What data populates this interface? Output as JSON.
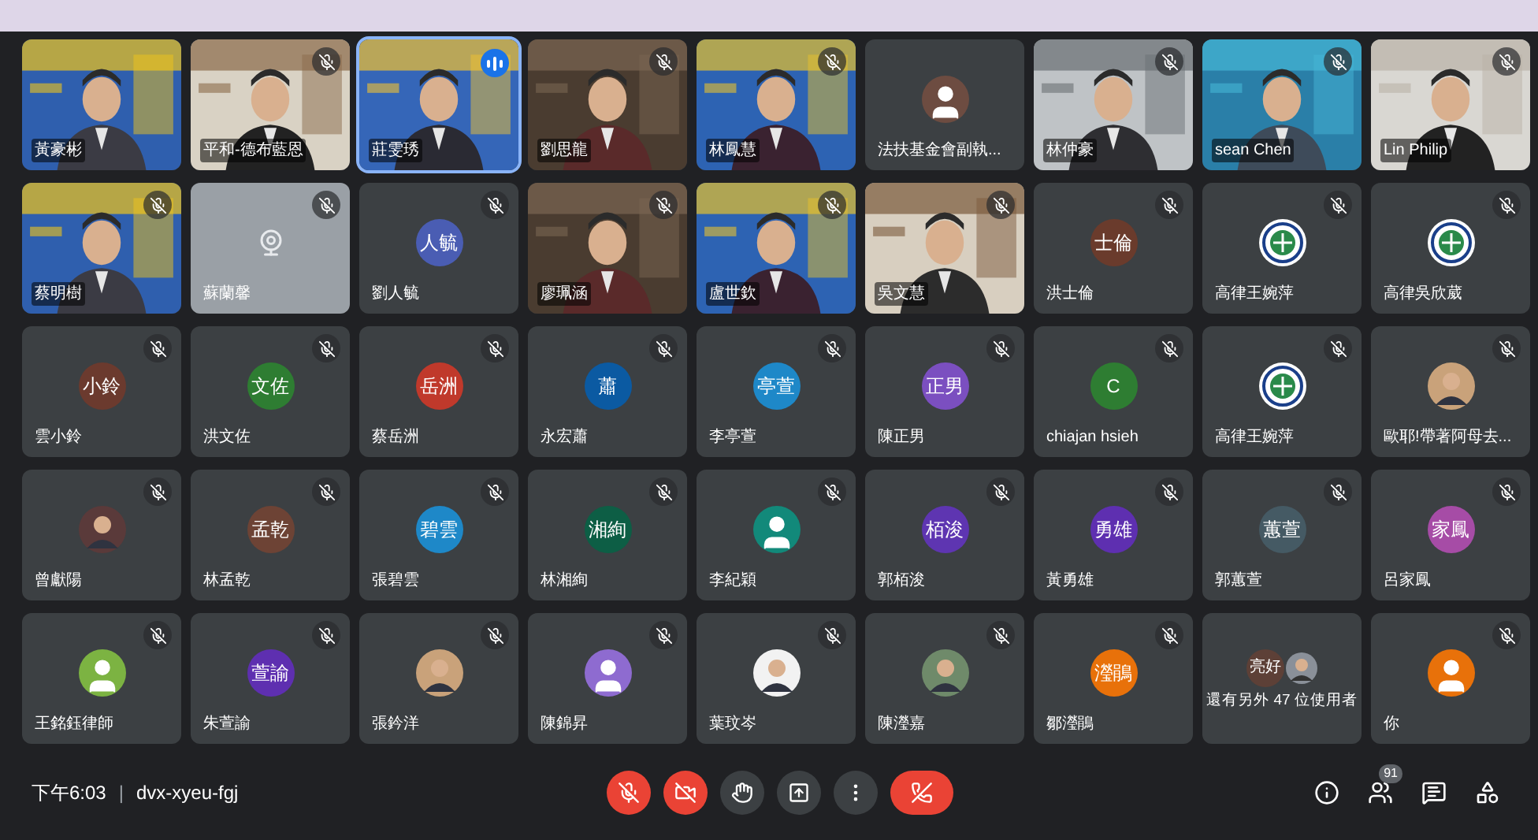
{
  "tiles": [
    {
      "name": "黃豪彬",
      "kind": "video",
      "muted": false,
      "speaking": false
    },
    {
      "name": "平和-德布藍恩",
      "kind": "video",
      "muted": true,
      "speaking": false
    },
    {
      "name": "莊雯琇",
      "kind": "video",
      "muted": false,
      "speaking": true
    },
    {
      "name": "劉思龍",
      "kind": "video",
      "muted": true,
      "speaking": false
    },
    {
      "name": "林鳳慧",
      "kind": "video",
      "muted": true,
      "speaking": false
    },
    {
      "name": "法扶基金會副執...",
      "kind": "person",
      "color": "#6d4c41",
      "muted": false,
      "speaking": false
    },
    {
      "name": "林仲豪",
      "kind": "video",
      "muted": true,
      "speaking": false
    },
    {
      "name": "sean Chen",
      "kind": "video",
      "muted": true,
      "speaking": false
    },
    {
      "name": "Lin Philip",
      "kind": "video",
      "muted": true,
      "speaking": false
    },
    {
      "name": "蔡明樹",
      "kind": "video",
      "muted": true,
      "speaking": false
    },
    {
      "name": "蘇蘭馨",
      "kind": "device",
      "muted": true,
      "speaking": false
    },
    {
      "name": "劉人毓",
      "kind": "initials",
      "initials": "人毓",
      "color": "#4a5db3",
      "muted": true,
      "speaking": false
    },
    {
      "name": "廖珮涵",
      "kind": "video",
      "muted": true,
      "speaking": false
    },
    {
      "name": "盧世欽",
      "kind": "video",
      "muted": true,
      "speaking": false
    },
    {
      "name": "吳文慧",
      "kind": "video",
      "muted": true,
      "speaking": false
    },
    {
      "name": "洪士倫",
      "kind": "initials",
      "initials": "士倫",
      "color": "#6a3b2c",
      "muted": true,
      "speaking": false
    },
    {
      "name": "高律王婉萍",
      "kind": "logo",
      "muted": true,
      "speaking": false
    },
    {
      "name": "高律吳欣葳",
      "kind": "logo",
      "muted": true,
      "speaking": false
    },
    {
      "name": "雲小鈴",
      "kind": "initials",
      "initials": "小鈴",
      "color": "#6b3a2e",
      "muted": true,
      "speaking": false
    },
    {
      "name": "洪文佐",
      "kind": "initials",
      "initials": "文佐",
      "color": "#2e7d32",
      "muted": true,
      "speaking": false
    },
    {
      "name": "蔡岳洲",
      "kind": "initials",
      "initials": "岳洲",
      "color": "#c0392b",
      "muted": true,
      "speaking": false
    },
    {
      "name": "永宏蕭",
      "kind": "initials",
      "initials": "蕭",
      "color": "#0b5aa2",
      "muted": true,
      "speaking": false
    },
    {
      "name": "李亭萱",
      "kind": "initials",
      "initials": "亭萱",
      "color": "#1e88c8",
      "muted": true,
      "speaking": false
    },
    {
      "name": "陳正男",
      "kind": "initials",
      "initials": "正男",
      "color": "#7b4fc0",
      "muted": true,
      "speaking": false
    },
    {
      "name": "chiajan hsieh",
      "kind": "initials",
      "initials": "C",
      "color": "#2e7d32",
      "muted": true,
      "speaking": false
    },
    {
      "name": "高律王婉萍",
      "kind": "logo",
      "muted": true,
      "speaking": false
    },
    {
      "name": "歐耶!帶著阿母去...",
      "muted": true,
      "speaking": false
    },
    {
      "name": "曾獻陽",
      "muted": true,
      "speaking": false
    },
    {
      "name": "林孟乾",
      "kind": "initials",
      "initials": "孟乾",
      "color": "#6d4335",
      "muted": true,
      "speaking": false
    },
    {
      "name": "張碧雲",
      "kind": "initials",
      "initials": "碧雲",
      "color": "#1e88c8",
      "muted": true,
      "speaking": false
    },
    {
      "name": "林湘絢",
      "kind": "initials",
      "initials": "湘絢",
      "color": "#0d5e45",
      "muted": true,
      "speaking": false
    },
    {
      "name": "李紀穎",
      "kind": "person",
      "color": "#12897a",
      "muted": true,
      "speaking": false
    },
    {
      "name": "郭栢浚",
      "kind": "initials",
      "initials": "栢浚",
      "color": "#5e35b1",
      "muted": true,
      "speaking": false
    },
    {
      "name": "黃勇雄",
      "kind": "initials",
      "initials": "勇雄",
      "color": "#5e2fb0",
      "muted": true,
      "speaking": false
    },
    {
      "name": "郭蕙萱",
      "kind": "initials",
      "initials": "蕙萱",
      "color": "#455a64",
      "muted": true,
      "speaking": false
    },
    {
      "name": "呂家鳳",
      "kind": "initials",
      "initials": "家鳳",
      "color": "#a64ca6",
      "muted": true,
      "speaking": false
    },
    {
      "name": "王銘鈺律師",
      "kind": "person",
      "color": "#7cb342",
      "muted": true,
      "speaking": false
    },
    {
      "name": "朱萱諭",
      "kind": "initials",
      "initials": "萱諭",
      "color": "#5e2fb0",
      "muted": true,
      "speaking": false
    },
    {
      "name": "張鈐洋",
      "muted": true,
      "speaking": false
    },
    {
      "name": "陳錦昇",
      "kind": "person",
      "color": "#8e6bd0",
      "muted": true,
      "speaking": false
    },
    {
      "name": "葉玟岑",
      "muted": true,
      "speaking": false
    },
    {
      "name": "陳瀅嘉",
      "muted": true,
      "speaking": false
    },
    {
      "name": "鄒瀅鵑",
      "kind": "initials",
      "initials": "瀅鵑",
      "color": "#e8710a",
      "muted": true,
      "speaking": false
    },
    {
      "name": "還有另外 47 位使用者",
      "kind": "overflow",
      "initials": "亮好",
      "muted": false,
      "speaking": false
    },
    {
      "name": "你",
      "kind": "person",
      "color": "#e8710a",
      "muted": true,
      "speaking": false
    }
  ],
  "bottom_bar": {
    "time": "下午6:03",
    "separator": "|",
    "meeting_code": "dvx-xyeu-fgj",
    "controls": [
      {
        "kind": "mic",
        "off": true
      },
      {
        "kind": "camera",
        "off": true
      },
      {
        "kind": "hand",
        "off": false
      },
      {
        "kind": "present",
        "off": false
      },
      {
        "kind": "more",
        "off": false
      },
      {
        "kind": "leave"
      }
    ],
    "side_buttons": [
      {
        "kind": "info"
      },
      {
        "kind": "people",
        "badge": "91"
      },
      {
        "kind": "chat"
      },
      {
        "kind": "activities"
      }
    ]
  }
}
